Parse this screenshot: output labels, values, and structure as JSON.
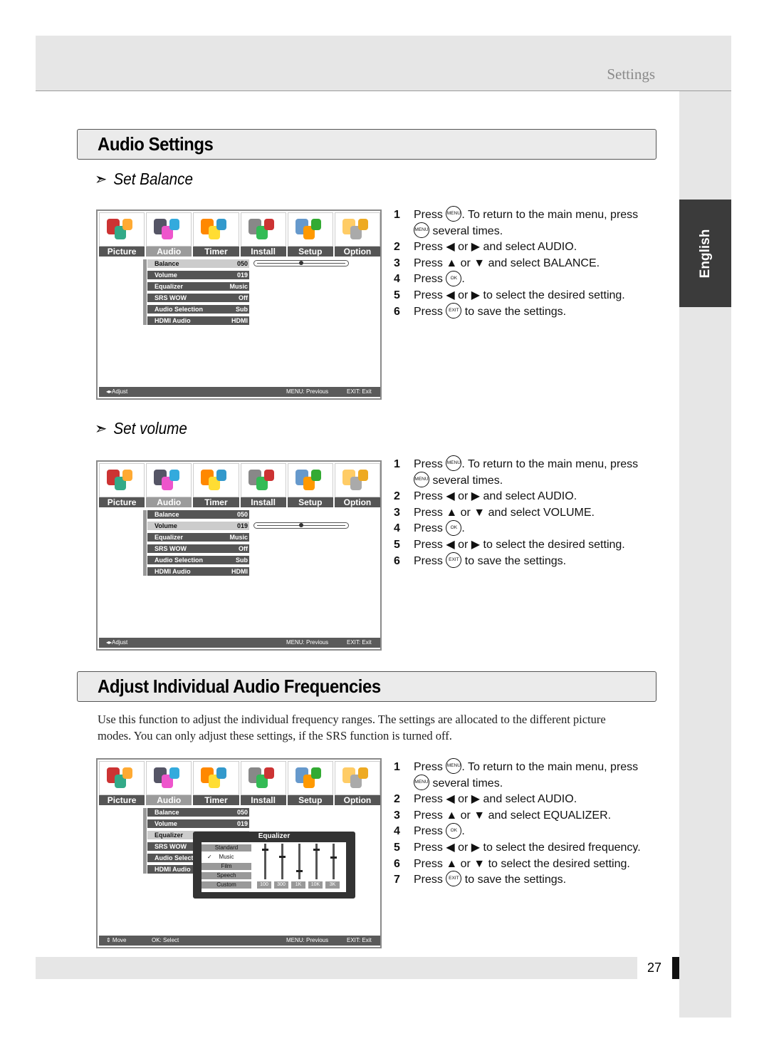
{
  "header": {
    "section": "Settings"
  },
  "side_tab": {
    "label": "English"
  },
  "page_number": "27",
  "sections": [
    {
      "title": "Audio Settings"
    },
    {
      "title": "Adjust Individual Audio Frequencies"
    }
  ],
  "subheadings": [
    {
      "arrow": "➣",
      "label": "Set Balance"
    },
    {
      "arrow": "➣",
      "label": "Set volume"
    }
  ],
  "paragraph": "Use this function to adjust the individual frequency ranges. The settings are allocated to the different picture modes. You can only adjust these settings, if the SRS function is turned off.",
  "osd": {
    "tabs": [
      "Picture",
      "Audio",
      "Timer",
      "Install",
      "Setup",
      "Option"
    ],
    "selected_tab": "Audio",
    "items": [
      {
        "label": "Balance",
        "value": "050"
      },
      {
        "label": "Volume",
        "value": "019"
      },
      {
        "label": "Equalizer",
        "value": "Music"
      },
      {
        "label": "SRS WOW",
        "value": "Off"
      },
      {
        "label": "Audio Selection",
        "value": "Sub"
      },
      {
        "label": "HDMI Audio",
        "value": "HDMI"
      }
    ],
    "screens": [
      {
        "selected_item": 0,
        "slider": 50,
        "footer": [
          "◂▸Adjust",
          "MENU: Previous",
          "EXIT: Exit"
        ]
      },
      {
        "selected_item": 1,
        "slider": 50,
        "footer": [
          "◂▸Adjust",
          "MENU: Previous",
          "EXIT: Exit"
        ]
      },
      {
        "selected_item": 2,
        "footer": [
          "⇕ Move",
          "OK: Select",
          "MENU: Previous",
          "EXIT: Exit"
        ],
        "equalizer": {
          "title": "Equalizer",
          "presets": [
            "Standard",
            "Music",
            "Film",
            "Speech",
            "Custom"
          ],
          "checked": "Music",
          "bands": [
            {
              "label": "100",
              "level": 85
            },
            {
              "label": "300",
              "level": 65
            },
            {
              "label": "1K",
              "level": 25
            },
            {
              "label": "10K",
              "level": 85
            },
            {
              "label": "3K",
              "level": 62
            }
          ]
        }
      }
    ]
  },
  "icons": {
    "menu": "MENU",
    "ok": "OK",
    "exit": "EXIT"
  },
  "instructions": [
    [
      [
        [
          "Press "
        ],
        [
          "@menu"
        ],
        [
          ". To return to the main menu, press"
        ]
      ],
      [
        [
          "@menu"
        ],
        [
          " several times."
        ]
      ],
      [
        [
          "Press ◀ or ▶ and select AUDIO."
        ]
      ],
      [
        [
          "Press ▲ or ▼ and select BALANCE."
        ]
      ],
      [
        [
          "Press "
        ],
        [
          "@ok"
        ],
        [
          "."
        ]
      ],
      [
        [
          "Press ◀ or ▶ to select the desired setting."
        ]
      ],
      [
        [
          "Press "
        ],
        [
          "@exit"
        ],
        [
          " to save the settings."
        ]
      ]
    ],
    [
      [
        [
          "Press "
        ],
        [
          "@menu"
        ],
        [
          ". To return to the main menu, press"
        ]
      ],
      [
        [
          "@menu"
        ],
        [
          " several times."
        ]
      ],
      [
        [
          "Press ◀ or ▶ and select AUDIO."
        ]
      ],
      [
        [
          "Press ▲ or ▼ and select VOLUME."
        ]
      ],
      [
        [
          "Press "
        ],
        [
          "@ok"
        ],
        [
          "."
        ]
      ],
      [
        [
          "Press ◀ or ▶ to select the desired setting."
        ]
      ],
      [
        [
          "Press "
        ],
        [
          "@exit"
        ],
        [
          " to save the settings."
        ]
      ]
    ],
    [
      [
        [
          "Press "
        ],
        [
          "@menu"
        ],
        [
          ". To return to the main menu, press"
        ]
      ],
      [
        [
          "@menu"
        ],
        [
          " several times."
        ]
      ],
      [
        [
          "Press ◀ or ▶ and select AUDIO."
        ]
      ],
      [
        [
          "Press ▲ or ▼ and select EQUALIZER."
        ]
      ],
      [
        [
          "Press "
        ],
        [
          "@ok"
        ],
        [
          "."
        ]
      ],
      [
        [
          "Press ◀ or ▶ to select the desired frequency."
        ]
      ],
      [
        [
          "Press ▲ or ▼ to select the desired setting."
        ]
      ],
      [
        [
          "Press "
        ],
        [
          "@exit"
        ],
        [
          " to save the settings."
        ]
      ]
    ]
  ],
  "step_numbers": [
    [
      "1",
      "",
      "2",
      "3",
      "4",
      "5",
      "6"
    ],
    [
      "1",
      "",
      "2",
      "3",
      "4",
      "5",
      "6"
    ],
    [
      "1",
      "",
      "2",
      "3",
      "4",
      "5",
      "6",
      "7"
    ]
  ]
}
